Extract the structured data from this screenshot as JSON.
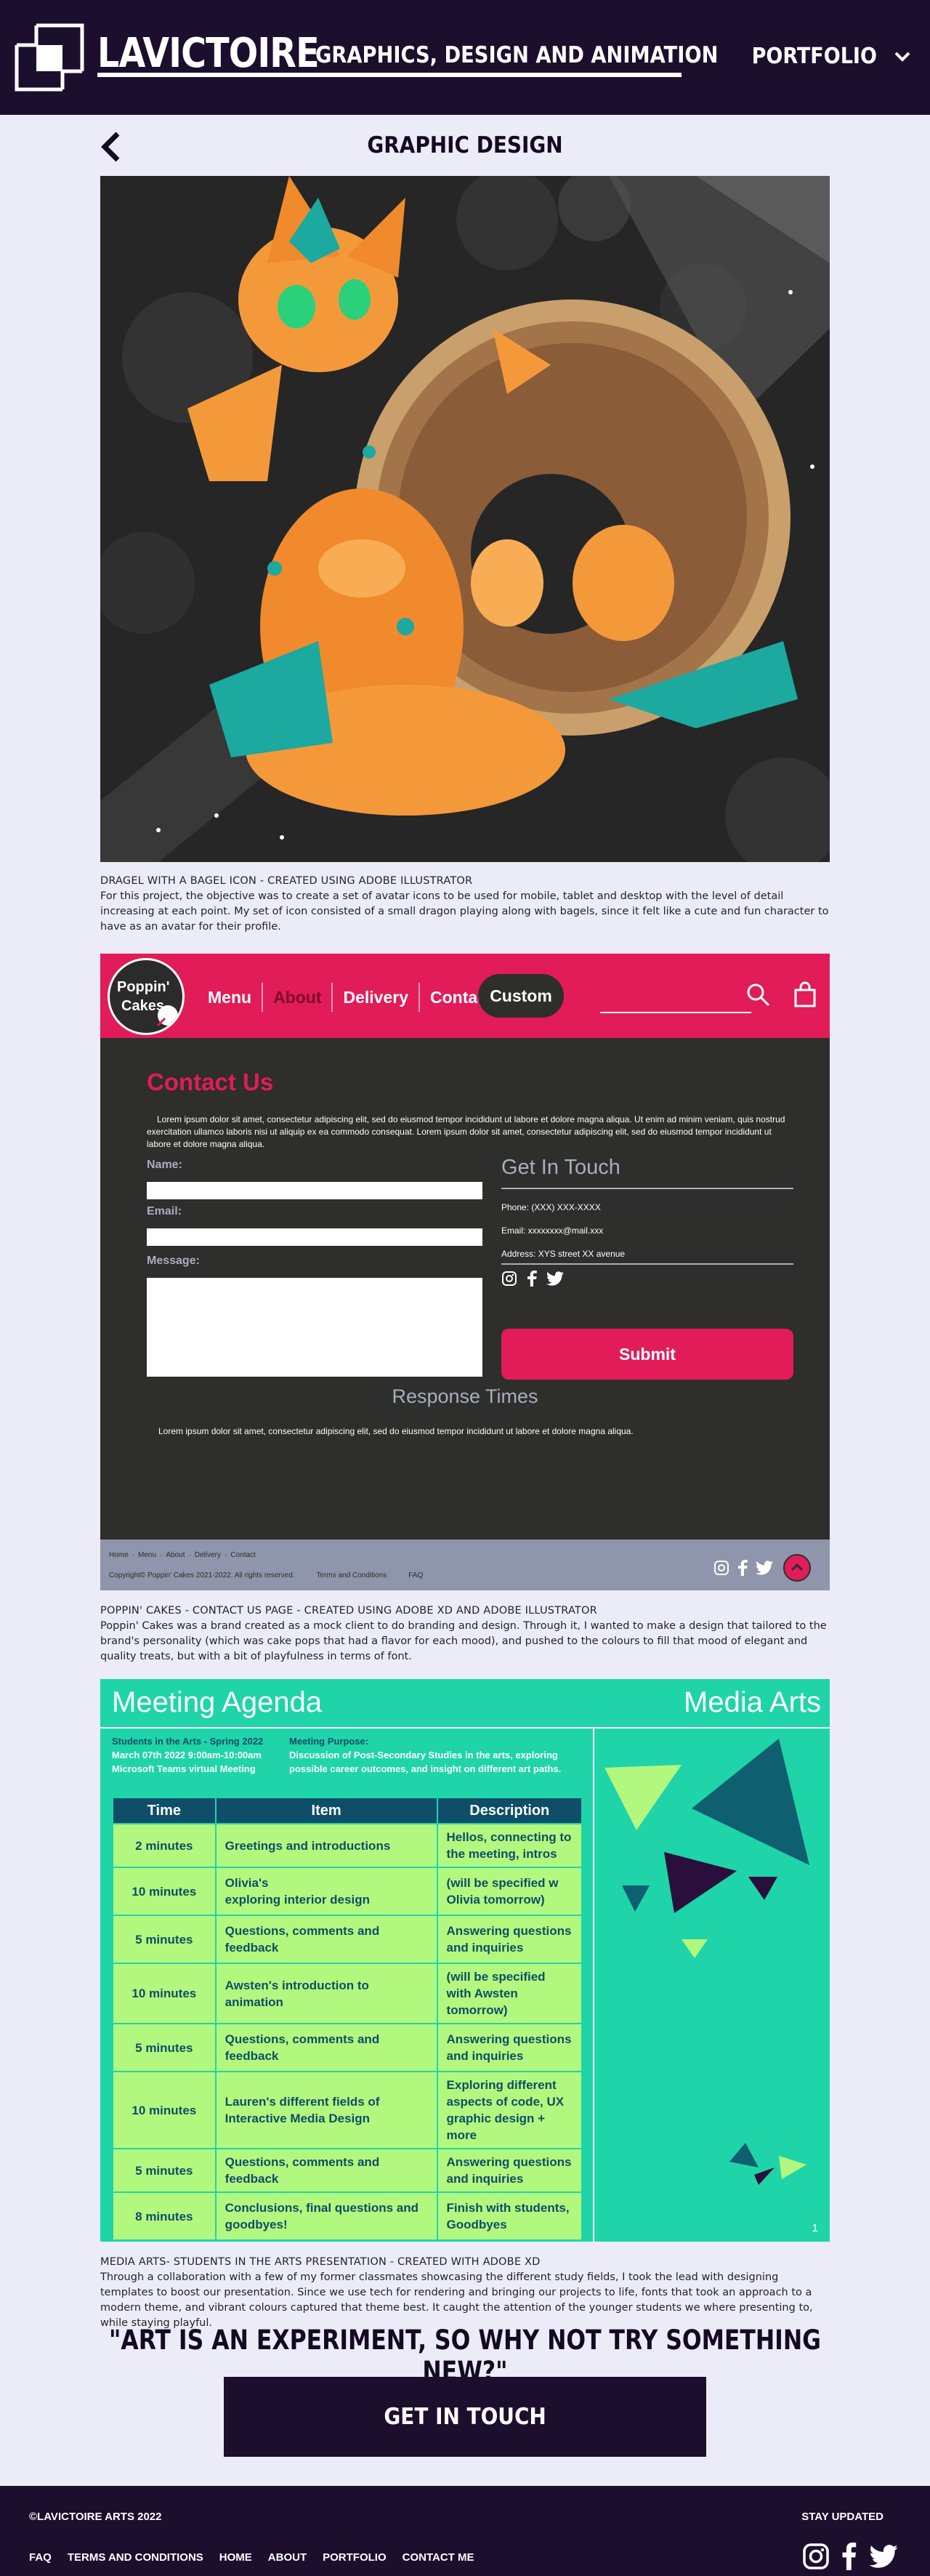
{
  "header": {
    "brand": "LAVICTOIRE",
    "tagline": "GRAPHICS, DESIGN AND ANIMATION",
    "nav_label": "PORTFOLIO"
  },
  "section": {
    "title": "GRAPHIC DESIGN"
  },
  "projects": [
    {
      "title": "DRAGEL WITH A BAGEL ICON - CREATED USING ADOBE ILLUSTRATOR",
      "description": "For this project, the objective was to create a set of avatar icons to be used for mobile, tablet and desktop with the level of detail increasing at each point. My set of icon consisted of a small dragon playing along with bagels, since it felt like a cute and fun character to have as an avatar for their profile."
    },
    {
      "title": "POPPIN' CAKES - CONTACT US PAGE - CREATED USING ADOBE XD AND ADOBE ILLUSTRATOR",
      "description": "Poppin' Cakes was a brand created as a mock client to do branding and design. Through it, I wanted to make a design that tailored to the brand's personality (which was cake pops that had a flavor for each mood), and pushed to the colours to fill that mood of elegant and quality treats, but with a bit of playfulness in terms of font."
    },
    {
      "title": "MEDIA ARTS- STUDENTS IN THE ARTS PRESENTATION - CREATED WITH ADOBE XD",
      "description": "Through a collaboration with a few of my former classmates showcasing the different study fields, I took the lead with designing templates to boost our presentation. Since we use tech for rendering and bringing our projects to life, fonts that took an approach to a modern theme, and vibrant colours captured that theme best. It caught the attention of the younger students we where presenting to, while staying playful."
    }
  ],
  "cakes": {
    "logo_line1": "Poppin'",
    "logo_line2": "Cakes",
    "nav": [
      "Menu",
      "About",
      "Delivery",
      "Contact"
    ],
    "custom": "Custom",
    "heading": "Contact Us",
    "intro": "Lorem ipsum dolor sit amet, consectetur adipiscing elit, sed do eiusmod tempor incididunt ut labore et dolore magna aliqua. Ut enim ad minim veniam, quis nostrud exercitation ullamco laboris nisi ut aliquip ex ea commodo consequat.  Lorem ipsum dolor sit amet, consectetur adipiscing elit, sed do eiusmod tempor incididunt ut labore et dolore magna aliqua.",
    "name_label": "Name:",
    "email_label": "Email:",
    "message_label": "Message:",
    "get_in_touch": "Get In Touch",
    "phone": "Phone: (XXX) XXX-XXXX",
    "email": "Email: xxxxxxxx@mail.xxx",
    "address": "Address: XYS street XX avenue",
    "submit": "Submit",
    "response_title": "Response Times",
    "response_text": "Lorem ipsum dolor sit amet, consectetur adipiscing elit, sed do eiusmod tempor incididunt ut labore et dolore magna aliqua.",
    "footer_links": [
      "Home",
      "Menu",
      "About",
      "Delivery",
      "Contact"
    ],
    "copyright": "Copyright© Poppin' Cakes 2021-2022. All rights reserved.",
    "terms": "Terms and Conditions",
    "faq": "FAQ"
  },
  "agenda": {
    "title": "Meeting Agenda",
    "brand": "Media Arts",
    "event": "Students in the Arts - Spring 2022",
    "date": "March 07th 2022 9:00am-10:00am",
    "platform": "Microsoft Teams virtual Meeting",
    "purpose_label": "Meeting Purpose:",
    "purpose": "Discussion of Post-Secondary Studies in the arts, exploring possible career outcomes, and insight on different art paths.",
    "headers": [
      "Time",
      "Item",
      "Description"
    ],
    "rows": [
      [
        "2 minutes",
        "Greetings and introductions",
        "Hellos, connecting to the meeting, intros"
      ],
      [
        "10 minutes",
        "Olivia's\nexploring interior design",
        "(will be specified w Olivia tomorrow)"
      ],
      [
        "5 minutes",
        "Questions, comments and feedback",
        "Answering questions and inquiries"
      ],
      [
        "10 minutes",
        "Awsten's introduction to animation",
        "(will be specified with Awsten tomorrow)"
      ],
      [
        "5 minutes",
        "Questions, comments and feedback",
        "Answering questions and inquiries"
      ],
      [
        "10 minutes",
        "Lauren's different fields of Interactive Media Design",
        "Exploring different aspects of code, UX graphic design + more"
      ],
      [
        "5 minutes",
        "Questions, comments and feedback",
        "Answering questions and inquiries"
      ],
      [
        "8 minutes",
        "Conclusions, final questions and goodbyes!",
        "Finish with students, Goodbyes"
      ]
    ],
    "page": "1"
  },
  "quote": "\"ART IS AN EXPERIMENT, SO WHY NOT TRY SOMETHING NEW?\"",
  "cta": "GET IN TOUCH",
  "footer": {
    "copyright": "©LAVICTOIRE ARTS 2022",
    "stay": "STAY UPDATED",
    "links": [
      "FAQ",
      "TERMS AND CONDITIONS",
      "HOME",
      "ABOUT",
      "PORTFOLIO",
      "CONTACT ME"
    ]
  },
  "colors": {
    "brand_dark": "#1c0f2e",
    "page_bg": "#ecebf8",
    "cakes_pink": "#e11c58",
    "agenda_teal": "#1fd4a9",
    "agenda_navy": "#0e4e68",
    "agenda_green": "#b2f87e"
  },
  "icons": [
    "logo-square-icon",
    "chevron-down-icon",
    "back-arrow-icon",
    "search-icon",
    "shopping-bag-icon",
    "instagram-icon",
    "facebook-icon",
    "twitter-icon",
    "back-to-top-icon"
  ]
}
